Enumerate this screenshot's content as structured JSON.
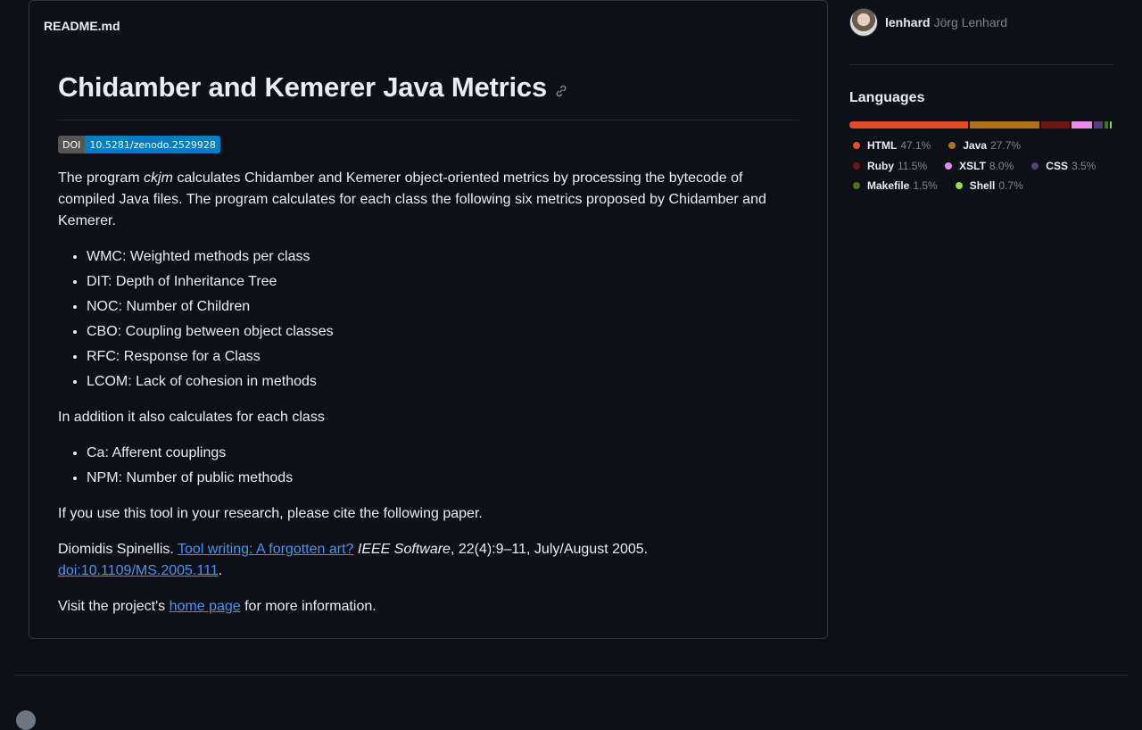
{
  "readme": {
    "filename": "README.md",
    "title": "Chidamber and Kemerer Java Metrics",
    "doi_badge": {
      "label": "DOI",
      "value": "10.5281/zenodo.2529928"
    },
    "intro": {
      "before": "The program ",
      "em": "ckjm",
      "after": " calculates Chidamber and Kemerer object-oriented metrics by processing the bytecode of compiled Java files. The program calculates for each class the following six metrics proposed by Chidamber and Kemerer."
    },
    "metrics": [
      "WMC: Weighted methods per class",
      "DIT: Depth of Inheritance Tree",
      "NOC: Number of Children",
      "CBO: Coupling between object classes",
      "RFC: Response for a Class",
      "LCOM: Lack of cohesion in methods"
    ],
    "addition": "In addition it also calculates for each class",
    "extra_metrics": [
      "Ca: Afferent couplings",
      "NPM: Number of public methods"
    ],
    "cite_prompt": "If you use this tool in your research, please cite the following paper.",
    "citation": {
      "author": "Diomidis Spinellis. ",
      "paper_link": "Tool writing: A forgotten art?",
      "journal": "IEEE Software",
      "details": ", 22(4):9–11, July/August 2005.",
      "doi_link": "doi:10.1109/MS.2005.111",
      "end": "."
    },
    "visit": {
      "before": "Visit the project's ",
      "link": "home page",
      "after": " for more information."
    }
  },
  "sidebar": {
    "contributor": {
      "login": "lenhard",
      "name": "Jörg Lenhard"
    },
    "languages_heading": "Languages",
    "languages": [
      {
        "name": "HTML",
        "percent": "47.1%",
        "value": 47.1,
        "color": "#e34c26"
      },
      {
        "name": "Java",
        "percent": "27.7%",
        "value": 27.7,
        "color": "#b07219"
      },
      {
        "name": "Ruby",
        "percent": "11.5%",
        "value": 11.5,
        "color": "#701516"
      },
      {
        "name": "XSLT",
        "percent": "8.0%",
        "value": 8.0,
        "color": "#eb8ceb"
      },
      {
        "name": "CSS",
        "percent": "3.5%",
        "value": 3.5,
        "color": "#563d7c"
      },
      {
        "name": "Makefile",
        "percent": "1.5%",
        "value": 1.5,
        "color": "#427819"
      },
      {
        "name": "Shell",
        "percent": "0.7%",
        "value": 0.7,
        "color": "#89e051"
      }
    ]
  }
}
